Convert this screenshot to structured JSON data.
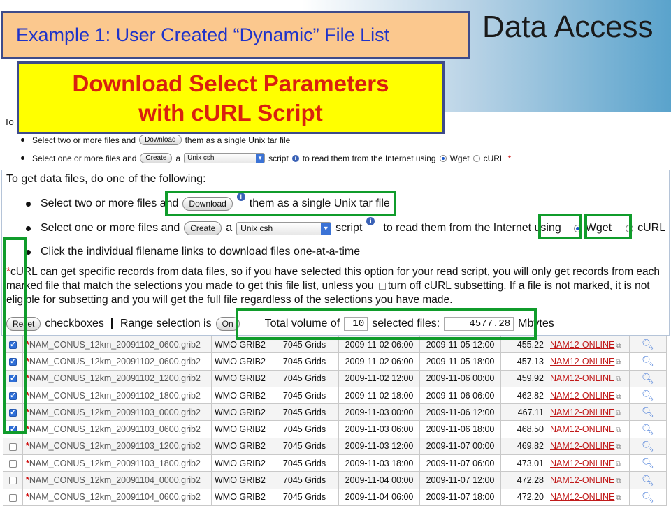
{
  "slide": {
    "title": "Data Access",
    "example_label": "Example 1: User Created “Dynamic” File List",
    "callout_line1": "Download Select Parameters",
    "callout_line2": "with cURL Script"
  },
  "small_panel": {
    "intro": "To",
    "row1_pre": "Select two or more files and",
    "row1_button": "Download",
    "row1_post": "them as a single Unix tar file",
    "row2_pre": "Select one or more files and",
    "row2_button": "Create",
    "row2_a": "a",
    "row2_select": "Unix csh",
    "row2_script": "script",
    "row2_post": "to read them from the Internet using",
    "wget": "Wget",
    "curl": "cURL",
    "star": "*"
  },
  "main_panel": {
    "intro": "To get data files, do one of the following:",
    "row1_pre": "Select two or more files and",
    "row1_button": "Download",
    "row1_post": "them as a single Unix tar file",
    "row2_pre": "Select one or more files and",
    "row2_button": "Create",
    "row2_a": "a",
    "row2_select": "Unix csh",
    "row2_script": "script",
    "row2_post": "to read them from the Internet using",
    "wget": "Wget",
    "curl": "cURL",
    "row3": "Click the individual filename links to download files one-at-a-time",
    "note_star": "*",
    "note_part1": "cURL can get specific records from data files, so if you have selected this option for your read script, you will only get records from each marked file that match the selections you made to get this file list, unless you",
    "note_part2": "turn off cURL subsetting. If a file is not marked, it is not eligible for subsetting and you will get the full file regardless of the selections you have made.",
    "reset_button": "Reset",
    "checkboxes_label": "checkboxes",
    "range_label": "Range selection is",
    "range_button": "On",
    "total_label": "Total volume of",
    "total_count": "10",
    "selected_label": "selected files:",
    "total_size": "4577.28",
    "unit": "Mbytes"
  },
  "table": {
    "rows": [
      {
        "checked": true,
        "name": "NAM_CONUS_12km_20091102_0600.grib2",
        "format": "WMO GRIB2",
        "grids": "7045 Grids",
        "begin": "2009-11-02 06:00",
        "end": "2009-11-05 12:00",
        "size": "455.22",
        "link": "NAM12-ONLINE"
      },
      {
        "checked": true,
        "name": "NAM_CONUS_12km_20091102_0600.grib2",
        "format": "WMO GRIB2",
        "grids": "7045 Grids",
        "begin": "2009-11-02 06:00",
        "end": "2009-11-05 18:00",
        "size": "457.13",
        "link": "NAM12-ONLINE"
      },
      {
        "checked": true,
        "name": "NAM_CONUS_12km_20091102_1200.grib2",
        "format": "WMO GRIB2",
        "grids": "7045 Grids",
        "begin": "2009-11-02 12:00",
        "end": "2009-11-06 00:00",
        "size": "459.92",
        "link": "NAM12-ONLINE"
      },
      {
        "checked": true,
        "name": "NAM_CONUS_12km_20091102_1800.grib2",
        "format": "WMO GRIB2",
        "grids": "7045 Grids",
        "begin": "2009-11-02 18:00",
        "end": "2009-11-06 06:00",
        "size": "462.82",
        "link": "NAM12-ONLINE"
      },
      {
        "checked": true,
        "name": "NAM_CONUS_12km_20091103_0000.grib2",
        "format": "WMO GRIB2",
        "grids": "7045 Grids",
        "begin": "2009-11-03 00:00",
        "end": "2009-11-06 12:00",
        "size": "467.11",
        "link": "NAM12-ONLINE"
      },
      {
        "checked": true,
        "name": "NAM_CONUS_12km_20091103_0600.grib2",
        "format": "WMO GRIB2",
        "grids": "7045 Grids",
        "begin": "2009-11-03 06:00",
        "end": "2009-11-06 18:00",
        "size": "468.50",
        "link": "NAM12-ONLINE"
      },
      {
        "checked": false,
        "name": "NAM_CONUS_12km_20091103_1200.grib2",
        "format": "WMO GRIB2",
        "grids": "7045 Grids",
        "begin": "2009-11-03 12:00",
        "end": "2009-11-07 00:00",
        "size": "469.82",
        "link": "NAM12-ONLINE"
      },
      {
        "checked": false,
        "name": "NAM_CONUS_12km_20091103_1800.grib2",
        "format": "WMO GRIB2",
        "grids": "7045 Grids",
        "begin": "2009-11-03 18:00",
        "end": "2009-11-07 06:00",
        "size": "473.01",
        "link": "NAM12-ONLINE"
      },
      {
        "checked": false,
        "name": "NAM_CONUS_12km_20091104_0000.grib2",
        "format": "WMO GRIB2",
        "grids": "7045 Grids",
        "begin": "2009-11-04 00:00",
        "end": "2009-11-07 12:00",
        "size": "472.28",
        "link": "NAM12-ONLINE"
      },
      {
        "checked": false,
        "name": "NAM_CONUS_12km_20091104_0600.grib2",
        "format": "WMO GRIB2",
        "grids": "7045 Grids",
        "begin": "2009-11-04 06:00",
        "end": "2009-11-07 18:00",
        "size": "472.20",
        "link": "NAM12-ONLINE"
      }
    ],
    "star": "*",
    "ext_icon": "external-link-icon",
    "inventory_icon": "magnifier-icon"
  },
  "colors": {
    "callout_text": "#d9200f",
    "callout_bg": "#ffff00",
    "example_bg": "#fbc88e",
    "example_text": "#1f33c9",
    "highlight": "#109c2b",
    "link": "#c11a1a"
  }
}
